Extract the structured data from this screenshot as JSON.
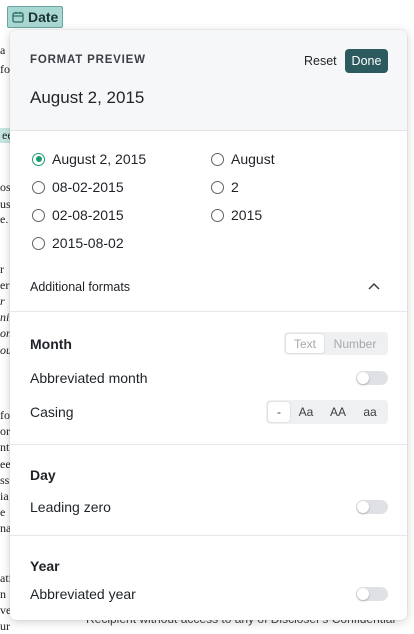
{
  "background": {
    "date_chip_label": "Date",
    "fragments": [
      "a",
      "fo",
      "ee",
      "os",
      "us",
      "e.",
      "r",
      "er",
      "r",
      "ni",
      "on",
      "ou",
      "fo",
      "or",
      "nt",
      "ee",
      "ss",
      "ia",
      "e",
      "na",
      "ati",
      "n",
      "ve",
      "ur"
    ],
    "bottom_text": "Recipient without access to any of Discloser's Confidential"
  },
  "panel": {
    "header_title": "FORMAT PREVIEW",
    "reset_label": "Reset",
    "done_label": "Done",
    "preview_value": "August 2, 2015"
  },
  "format_options": {
    "left": [
      {
        "label": "August 2, 2015",
        "selected": true
      },
      {
        "label": "08-02-2015",
        "selected": false
      },
      {
        "label": "02-08-2015",
        "selected": false
      },
      {
        "label": "2015-08-02",
        "selected": false
      }
    ],
    "right": [
      {
        "label": "August",
        "selected": false
      },
      {
        "label": "2",
        "selected": false
      },
      {
        "label": "2015",
        "selected": false
      }
    ]
  },
  "additional_formats_label": "Additional formats",
  "month": {
    "title": "Month",
    "display_options": [
      "Text",
      "Number"
    ],
    "abbreviated_label": "Abbreviated month",
    "abbreviated_on": false,
    "casing_label": "Casing",
    "casing_options": [
      "-",
      "Aa",
      "AA",
      "aa"
    ]
  },
  "day": {
    "title": "Day",
    "leading_zero_label": "Leading zero",
    "leading_zero_on": false
  },
  "year": {
    "title": "Year",
    "abbreviated_label": "Abbreviated year",
    "abbreviated_on": false
  },
  "colors": {
    "accent": "#1a9b73",
    "done_button": "#2c5b5f",
    "chip": "#a9d7d2"
  }
}
